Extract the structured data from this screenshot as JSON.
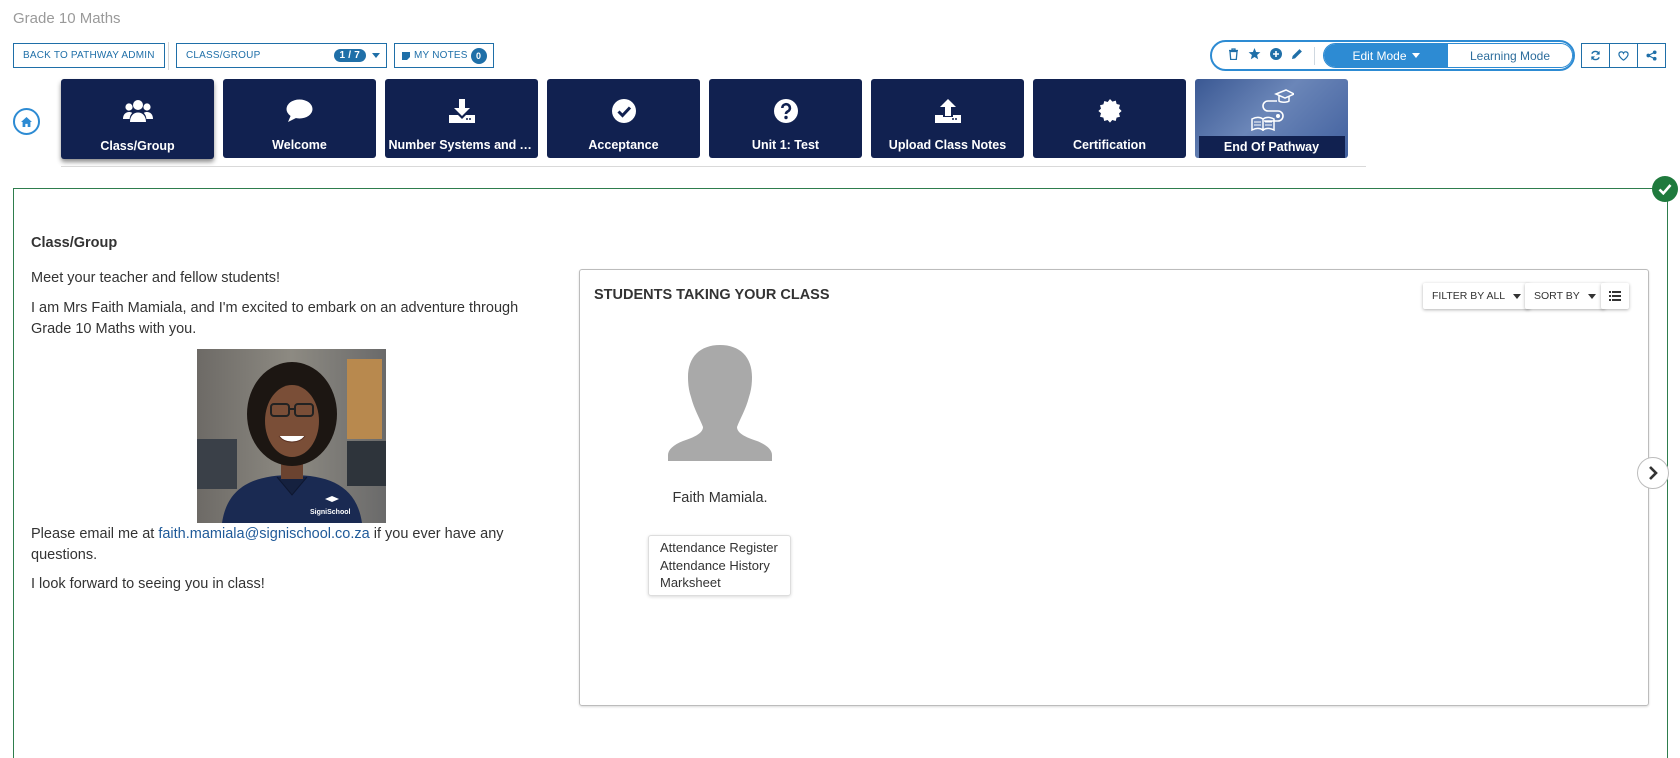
{
  "page": {
    "title": "Grade 10 Maths"
  },
  "toolbar": {
    "back_label": "BACK TO PATHWAY ADMIN",
    "class_select_label": "CLASS/GROUP",
    "class_select_position": "1 / 7",
    "notes_label": "MY NOTES",
    "notes_count": "0",
    "edit_mode_label": "Edit Mode",
    "learning_mode_label": "Learning Mode",
    "active_mode": "Edit Mode",
    "tool_icons": [
      "trash-icon",
      "star-icon",
      "plus-circle-icon",
      "pencil-icon"
    ],
    "right_icons": [
      "refresh-icon",
      "heart-icon",
      "share-icon"
    ]
  },
  "tiles": [
    {
      "label": "Class/Group",
      "icon": "users-icon",
      "active": true
    },
    {
      "label": "Welcome",
      "icon": "speech-bubble-icon"
    },
    {
      "label": "Number Systems and Alg...",
      "icon": "download-icon"
    },
    {
      "label": "Acceptance",
      "icon": "check-circle-icon"
    },
    {
      "label": "Unit 1: Test",
      "icon": "question-circle-icon"
    },
    {
      "label": "Upload Class Notes",
      "icon": "upload-icon"
    },
    {
      "label": "Certification",
      "icon": "certificate-icon"
    },
    {
      "label": "End Of Pathway",
      "icon": "graduation-path-icon"
    }
  ],
  "content": {
    "section_title": "Class/Group",
    "intro": "Meet your teacher and fellow students!",
    "teacher_intro": "I am Mrs Faith Mamiala, and I'm excited to embark on an adventure through Grade 10 Maths with you.",
    "email_prefix": "Please email me at ",
    "email": "faith.mamiala@signischool.co.za",
    "email_suffix": " if you ever have any questions.",
    "closing": "I look forward to seeing you in class!",
    "photo_logo_text": "SigniSchool"
  },
  "students_panel": {
    "title": "STUDENTS TAKING YOUR CLASS",
    "filter_label": "FILTER BY ALL",
    "sort_label": "SORT BY",
    "students": [
      {
        "name": "Faith Mamiala.",
        "menu": [
          "Attendance Register",
          "Attendance History",
          "Marksheet"
        ]
      }
    ]
  },
  "colors": {
    "accent": "#2d8bd3",
    "tile_bg": "#112150",
    "complete": "#1f7a3d"
  }
}
